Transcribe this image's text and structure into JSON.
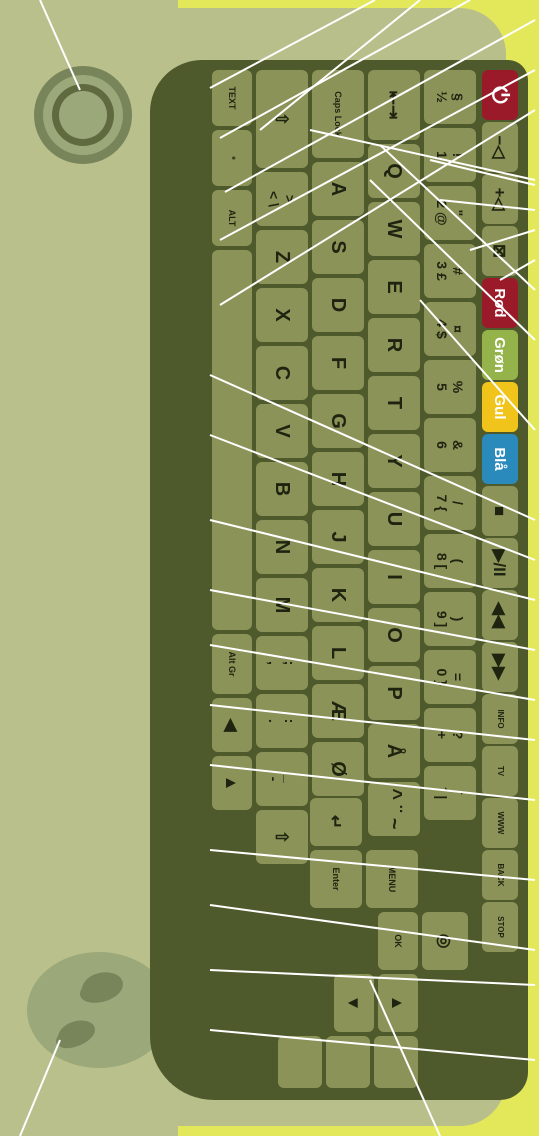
{
  "keyboard": {
    "function_row": [
      "",
      "",
      "",
      "",
      "",
      "",
      "",
      "",
      "",
      "",
      "",
      "",
      "INFO",
      "TV",
      "WWW",
      "BACK",
      "STOP"
    ],
    "color_keys": {
      "red": "Rød",
      "green": "Grøn",
      "yellow": "Gul",
      "blue": "Blå"
    },
    "number_row": [
      {
        "top": "§",
        "bottom": "½"
      },
      {
        "top": "!",
        "bottom": "1"
      },
      {
        "top": "\"",
        "bottom": "2 @"
      },
      {
        "top": "#",
        "bottom": "3 £"
      },
      {
        "top": "¤",
        "bottom": "4 $"
      },
      {
        "top": "%",
        "bottom": "5"
      },
      {
        "top": "&",
        "bottom": "6"
      },
      {
        "top": "/",
        "bottom": "7 {"
      },
      {
        "top": "(",
        "bottom": "8 ["
      },
      {
        "top": ")",
        "bottom": "9 ]"
      },
      {
        "top": "=",
        "bottom": "0 }"
      },
      {
        "top": "?",
        "bottom": "+"
      },
      {
        "top": "`",
        "bottom": "´ |"
      }
    ],
    "row_q": [
      "Q",
      "W",
      "E",
      "R",
      "T",
      "Y",
      "U",
      "I",
      "O",
      "P",
      "Å",
      "^ ¨ ~"
    ],
    "row_a": [
      "A",
      "S",
      "D",
      "F",
      "G",
      "H",
      "J",
      "K",
      "L",
      "Æ",
      "Ø",
      "Enter"
    ],
    "row_z": [
      "Z",
      "X",
      "C",
      "V",
      "B",
      "N",
      "M"
    ],
    "row_z_dual": [
      {
        "top": ">",
        "bottom": "< \\"
      },
      {
        "top": ";",
        "bottom": ","
      },
      {
        "top": ":",
        "bottom": "."
      },
      {
        "top": "_",
        "bottom": "-"
      }
    ],
    "caps_lock": "Caps Lock",
    "menu": "MENU",
    "ok": "OK",
    "enter": "Enter",
    "bottom_row": {
      "text": "TEXT",
      "asterisk": "*",
      "apostrophe": "'",
      "alt": "ALT",
      "alt_gr": "Alt Gr"
    },
    "tab_icon": "tab-icon",
    "shift_icon": "shift-arrow-icon"
  },
  "colors": {
    "background": "#e3e85a",
    "case": "#b9bf8b",
    "keyboard_frame": "#4f5a2c",
    "key": "#8c9358",
    "red": "#9a1a2a",
    "green": "#94b34a",
    "yellow": "#f0c41a",
    "blue": "#2a8abb"
  }
}
